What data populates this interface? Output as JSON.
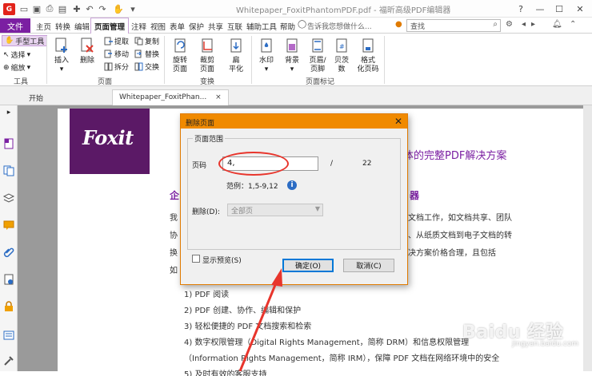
{
  "title_bar": {
    "title": "Whitepaper_FoxitPhantomPDF.pdf - 福昕高级PDF编辑器",
    "logo_text": "G",
    "window_controls": [
      "?",
      "—",
      "☐",
      "✕"
    ]
  },
  "menubar": {
    "file_label": "文件",
    "items": [
      "主页",
      "转换",
      "编辑",
      "页面管理",
      "注释",
      "视图",
      "表单",
      "保护",
      "共享",
      "互联",
      "辅助工具",
      "帮助"
    ],
    "active_item": "页面管理",
    "search_hint": "告诉我您想做什么...",
    "search_placeholder": "查找"
  },
  "ribbon": {
    "tools": {
      "hand": "手型工具",
      "select": "选择",
      "zoom": "缩放",
      "label": "工具"
    },
    "pages_group": {
      "insert": "插入",
      "delete": "删除",
      "extract": "提取",
      "move": "移动",
      "split": "拆分",
      "copy": "复制",
      "replace": "替换",
      "swap": "交换",
      "label": "页面"
    },
    "transform_group": {
      "rotate": [
        "旋转",
        "页面"
      ],
      "crop": [
        "裁剪",
        "页面"
      ],
      "flatten": [
        "扁",
        "平化"
      ],
      "label": "变换"
    },
    "marks_group": {
      "watermark": "水印",
      "background": "背景",
      "header_footer": [
        "页眉/",
        "页脚"
      ],
      "bates": [
        "贝茨",
        "数"
      ],
      "format_page_number": [
        "格式",
        "化页码"
      ],
      "label": "页面标记"
    }
  },
  "tabs": {
    "start": "开始",
    "doc": "Whitepaper_FoxitPhan...",
    "close": "×"
  },
  "page": {
    "logo": "Foxit",
    "heading_tail": "体的完整PDF解决方案",
    "sub1": "企",
    "sub2": "器",
    "left_chars": [
      "我",
      "协",
      "换",
      "如"
    ],
    "right_lines": [
      "文档工作，如文档共享、团队",
      "、从纸质文档到电子文档的转",
      "决方案价格合理，且包括"
    ],
    "items": [
      "1)   PDF 阅读",
      "2)   PDF 创建、协作、编辑和保护",
      "3)   轻松便捷的 PDF 文档搜索和检索",
      "4)   数字权限管理（Digital Rights Management，简称 DRM）和信息权限管理",
      "       （Information Rights Management，简称 IRM），保障 PDF 文档在网络环境中的安全",
      "5)   及时有效的客服支持"
    ]
  },
  "dialog": {
    "title": "删除页面",
    "close": "✕",
    "range_legend": "页面范围",
    "pages_label": "页码",
    "pages_value": "4,",
    "separator": "/",
    "total_pages": "22",
    "example": "范例：1,5-9,12",
    "delete_label": "删除(D):",
    "delete_option": "全部页",
    "show_preview": "显示预览(S)",
    "ok": "确定(O)",
    "cancel": "取消(C)"
  },
  "watermark": {
    "text": "Baidu 经验",
    "sub": "jingyan.baidu.com"
  },
  "colors": {
    "accent": "#7b1fa2",
    "dialog_title": "#f08a00",
    "annotation": "#e8352c"
  }
}
